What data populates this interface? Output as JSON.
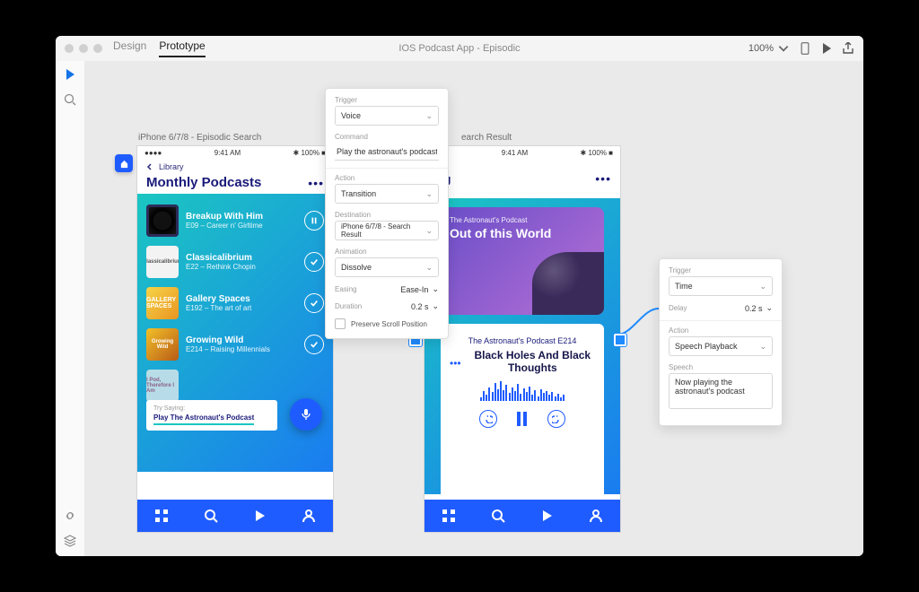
{
  "window": {
    "tabs": {
      "design": "Design",
      "prototype": "Prototype"
    },
    "doc_title": "IOS Podcast App - Episodic",
    "zoom": "100%"
  },
  "artboard1": {
    "label": "iPhone 6/7/8 - Episodic Search",
    "clock": "9:41 AM",
    "battery": "100%",
    "back": "Library",
    "title": "Monthly Podcasts",
    "more": "•••",
    "podcasts": [
      {
        "name": "Breakup With Him",
        "ep": "E09 – Career n' Girltime",
        "art": "",
        "icon": "pause"
      },
      {
        "name": "Classicalibrium",
        "ep": "E22 – Rethink Chopin",
        "art": "Classicalibrium",
        "icon": "check"
      },
      {
        "name": "Gallery Spaces",
        "ep": "E192 – The art of art",
        "art": "GALLERY SPACES",
        "icon": "check"
      },
      {
        "name": "Growing Wild",
        "ep": "E214 – Raising Millennials",
        "art": "Growing Wild",
        "icon": "check"
      },
      {
        "name": "",
        "ep": "",
        "art": "I Pod, Therefore I Am",
        "icon": ""
      }
    ],
    "try_label": "Try Saying:",
    "try_text": "Play The Astronaut's Podcast"
  },
  "artboard2": {
    "label": "earch Result",
    "clock": "9:41 AM",
    "battery": "100%",
    "now_playing": "ing",
    "more": "•••",
    "hero_tag": "The Astronaut's Podcast",
    "hero_title": "Out of this World",
    "series": "The Astronaut's Podcast E214",
    "track": "Black Holes And Black Thoughts",
    "ellipsis": "•••"
  },
  "panel1": {
    "trigger_lbl": "Trigger",
    "trigger_val": "Voice",
    "command_lbl": "Command",
    "command_val": "Play the astronaut's podcast",
    "action_lbl": "Action",
    "action_val": "Transition",
    "dest_lbl": "Destination",
    "dest_val": "iPhone 6/7/8 - Search Result",
    "anim_lbl": "Animation",
    "anim_val": "Dissolve",
    "easing_lbl": "Easing",
    "easing_val": "Ease-In",
    "dur_lbl": "Duration",
    "dur_val": "0.2 s",
    "preserve": "Preserve Scroll Position"
  },
  "panel2": {
    "trigger_lbl": "Trigger",
    "trigger_val": "Time",
    "delay_lbl": "Delay",
    "delay_val": "0.2 s",
    "action_lbl": "Action",
    "action_val": "Speech Playback",
    "speech_lbl": "Speech",
    "speech_val": "Now playing the astronaut's podcast"
  }
}
